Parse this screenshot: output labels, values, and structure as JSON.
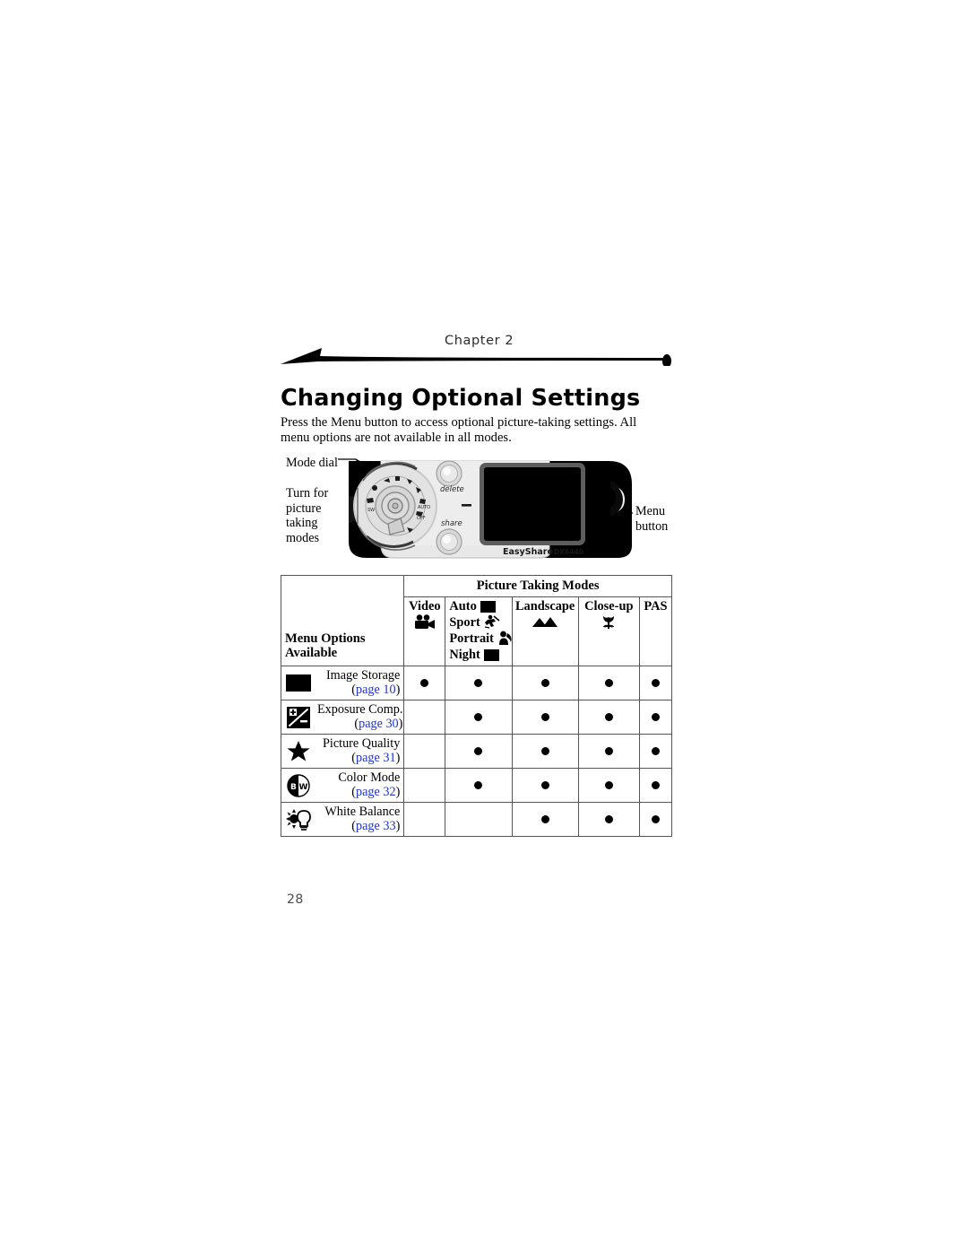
{
  "header": {
    "chapter_label": "Chapter 2",
    "title": "Changing Optional Settings"
  },
  "intro": {
    "paragraph": "Press the Menu button to access optional picture-taking settings. All menu options are not available in all modes."
  },
  "figure": {
    "callout_mode_dial": "Mode dial",
    "callout_turn_for": "Turn for\npicture\ntaking\nmodes",
    "callout_menu_button": "Menu\nbutton",
    "camera_brand": "EasyShare",
    "camera_model": "DX6440",
    "button_delete_label": "delete",
    "button_share_label": "share"
  },
  "table": {
    "group_header": "Picture Taking Modes",
    "row_header_label": "Menu Options\nAvailable",
    "columns": [
      {
        "label": "Video",
        "icon": "video-camera-icon",
        "layout": "stack"
      },
      {
        "label": "Auto",
        "icon": "black-square-icon",
        "layout": "inline",
        "extra_rows": [
          {
            "label": "Sport",
            "icon": "runner-icon"
          },
          {
            "label": "Portrait",
            "icon": "portrait-head-icon"
          },
          {
            "label": "Night",
            "icon": "black-square-icon"
          }
        ]
      },
      {
        "label": "Landscape",
        "icon": "mountains-icon",
        "layout": "stack"
      },
      {
        "label": "Close-up",
        "icon": "tulip-icon",
        "layout": "stack"
      },
      {
        "label": "PAS",
        "icon": "",
        "layout": "text-only"
      }
    ],
    "page_word": "page",
    "rows": [
      {
        "icon": "black-rectangle-icon",
        "name": "Image Storage",
        "page": "10",
        "availability": [
          true,
          true,
          true,
          true,
          true
        ]
      },
      {
        "icon": "exposure-compensation-icon",
        "name": "Exposure Comp.",
        "page": "30",
        "availability": [
          false,
          true,
          true,
          true,
          true
        ]
      },
      {
        "icon": "star-icon",
        "name": "Picture Quality",
        "page": "31",
        "availability": [
          false,
          true,
          true,
          true,
          true
        ]
      },
      {
        "icon": "black-white-circle-icon",
        "name": "Color Mode",
        "page": "32",
        "availability": [
          false,
          true,
          true,
          true,
          true
        ]
      },
      {
        "icon": "sun-bulb-icon",
        "name": "White Balance",
        "page": "33",
        "availability": [
          false,
          false,
          true,
          true,
          true
        ]
      }
    ]
  },
  "folio": {
    "page_number": "28"
  },
  "colors": {
    "link": "#2134c9",
    "text": "#000000",
    "rule": "#555555",
    "chapter_label": "#2b2b2b"
  }
}
